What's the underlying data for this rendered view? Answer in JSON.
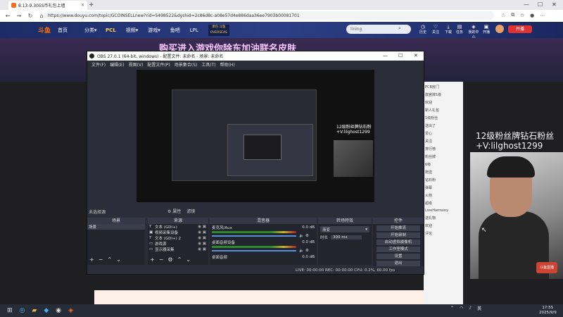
{
  "browser": {
    "tab_title": "8.13-9.30SS币礼包上墙",
    "url": "https://www.douyu.com/topic/GCOINSELLnew?rid=5498522&dyshid=2c86d8c-a08e57d4e886daa36ee7903b00081701",
    "window_min": "—",
    "window_max": "☐",
    "window_close": "✕"
  },
  "douyu": {
    "brand": "斗鱼",
    "nav": [
      "首页",
      "分类▾",
      "PCL",
      "视频▾",
      "游戏▾",
      "鱼吧",
      "LPL"
    ],
    "promo": "承包 斗鱼 OVERSEAS",
    "search_placeholder": "lining",
    "header_icons": [
      {
        "icon": "history",
        "label": "历史"
      },
      {
        "icon": "follow",
        "label": "关注"
      },
      {
        "icon": "download",
        "label": "下载"
      },
      {
        "icon": "task",
        "label": "任务"
      },
      {
        "icon": "recharge",
        "label": "我的中心"
      },
      {
        "icon": "beacon",
        "label": "开播"
      }
    ],
    "open_button": "开播",
    "banner_text": "购买进入游戏你除东加油联名皮肤"
  },
  "obs": {
    "title": "OBS 27.0.1 (64-bit, windows) - 配置文件: 未命名 - 场景: 未命名",
    "menu": [
      "文件(F)",
      "编辑(E)",
      "视图(V)",
      "配置文件(P)",
      "场景集合(S)",
      "工具(T)",
      "帮助(H)"
    ],
    "no_source": "未选择源",
    "props_button": "⚙ 属性",
    "filters_button": "滤镜",
    "scenes_header": "场景",
    "sources_header": "来源",
    "mixer_header": "混音器",
    "transitions_header": "转场特效",
    "controls_header": "控件",
    "scene_item": "场景",
    "sources": [
      {
        "icon": "T",
        "name": "文本 (GDI+)"
      },
      {
        "icon": "▣",
        "name": "视频采集设备"
      },
      {
        "icon": "T",
        "name": "文本 (GDI+) 2"
      },
      {
        "icon": "▭",
        "name": "游戏源"
      },
      {
        "icon": "▭",
        "name": "显示器采集"
      }
    ],
    "mixer_rows": [
      {
        "name": "麦克风/Aux",
        "db": "0.0 dB"
      },
      {
        "name": "桌面音频设备",
        "db": "0.0 dB"
      },
      {
        "name": "桌面音频",
        "db": "0.0 dB"
      }
    ],
    "transition_type": "渐变",
    "duration_label": "时长",
    "duration_value": "300 ms",
    "control_buttons": [
      "开始推流",
      "开始录制",
      "启动虚拟摄像机",
      "工作室模式",
      "设置",
      "退出"
    ],
    "status": "LIVE: 00:00:00   REC: 00:00:00   CPU: 0.2%, 60.00 fps",
    "preview_overlay_line1": "12级粉丝牌钻石粉",
    "preview_overlay_line2": "+V:lilghost1299"
  },
  "chat": {
    "lines": [
      "PCB房门",
      "旗官牌1级",
      "欢迎",
      "新人礼包",
      "1级粉丝",
      "送出了",
      "爱心",
      "关注",
      "排行榜",
      "粉丝牌",
      "6级",
      "赠送",
      "钻石粉",
      "弹幕",
      "火箭",
      "超级",
      "LiveHarmony",
      "送礼物",
      "欢迎",
      "评论"
    ]
  },
  "webcam": {
    "line1": "12级粉丝牌钻石粉丝",
    "line2": "+V:lilghost1299",
    "badge": "斗鱼直播"
  },
  "taskbar": {
    "lang": "英",
    "time": "17:55",
    "date": "2025/9/9"
  }
}
